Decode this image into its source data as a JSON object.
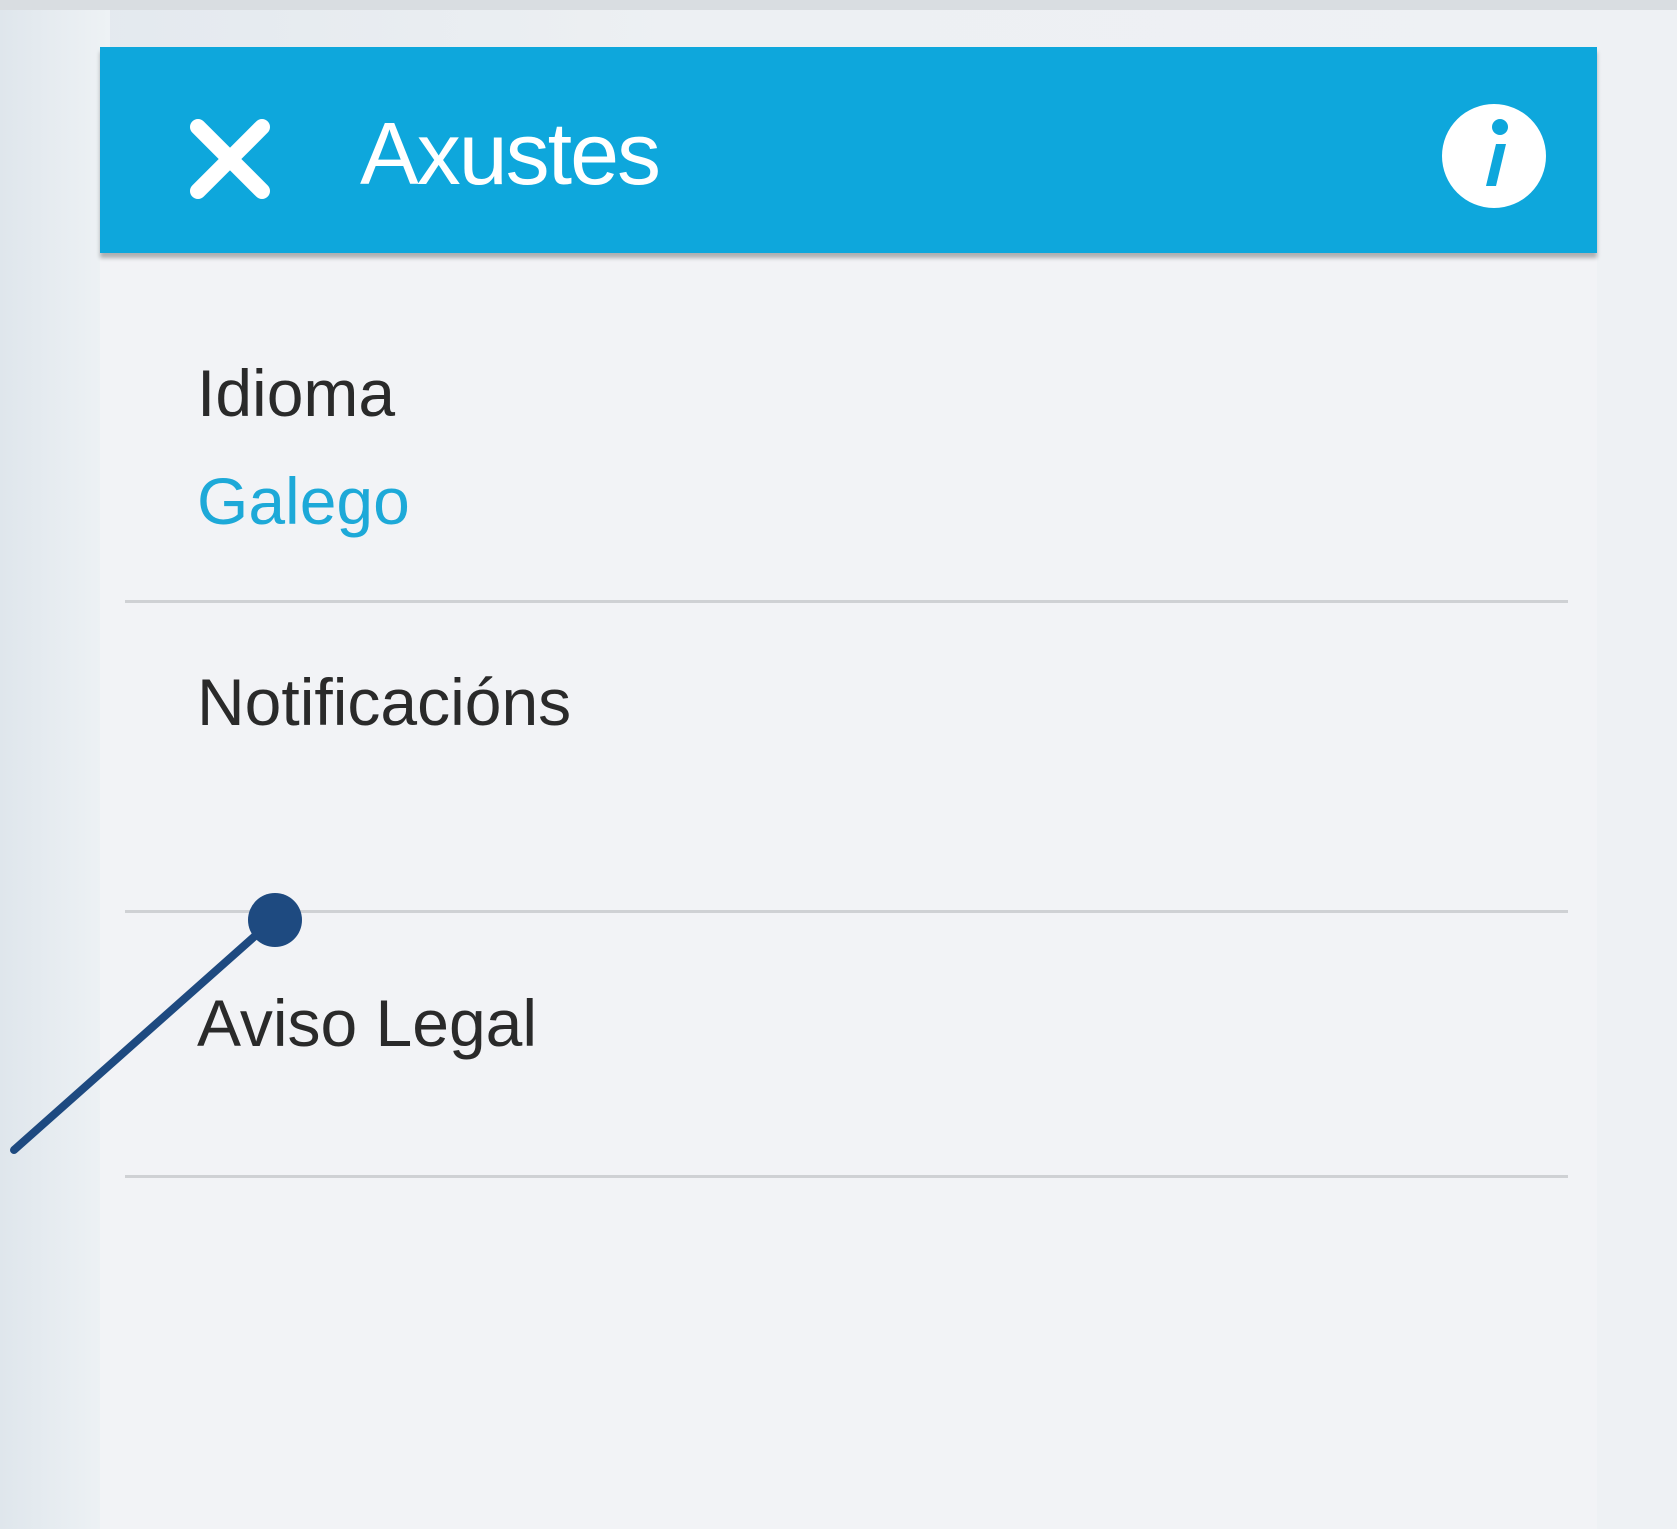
{
  "header": {
    "title": "Axustes",
    "background_color": "#0ea7dc"
  },
  "settings": {
    "language": {
      "label": "Idioma",
      "value": "Galego",
      "value_color": "#1da9d8"
    },
    "notifications": {
      "label": "Notificacións"
    },
    "legal": {
      "label": "Aviso Legal"
    }
  },
  "icons": {
    "close": "close-icon",
    "info": "info-icon"
  },
  "annotation": {
    "color": "#1e4a80"
  }
}
